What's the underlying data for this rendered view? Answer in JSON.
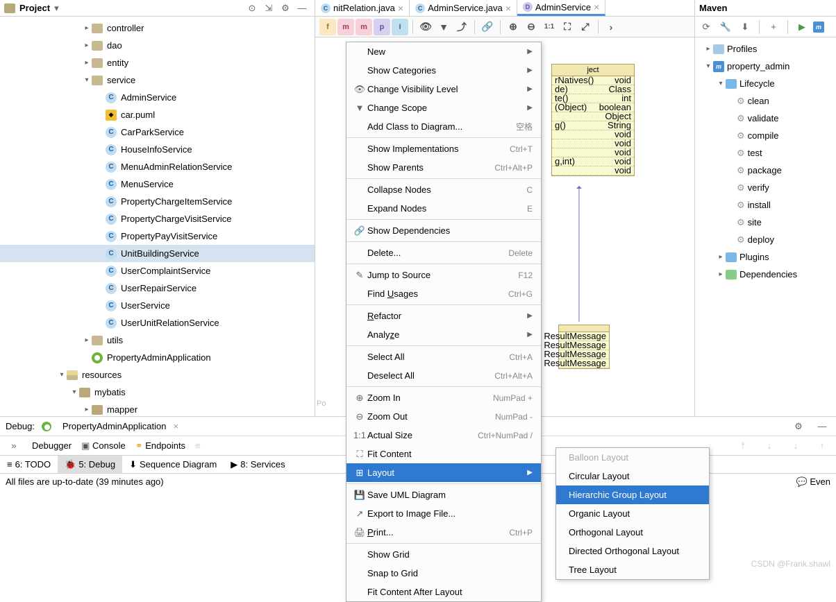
{
  "project": {
    "title": "Project",
    "tree": {
      "controller": "controller",
      "dao": "dao",
      "entity": "entity",
      "service": "service",
      "service_items": [
        "AdminService",
        "car.puml",
        "CarParkService",
        "HouseInfoService",
        "MenuAdminRelationService",
        "MenuService",
        "PropertyChargeItemService",
        "PropertyChargeVisitService",
        "PropertyPayVisitService",
        "UnitBuildingService",
        "UserComplaintService",
        "UserRepairService",
        "UserService",
        "UserUnitRelationService"
      ],
      "utils": "utils",
      "app": "PropertyAdminApplication",
      "resources": "resources",
      "mybatis": "mybatis",
      "mapper": "mapper"
    }
  },
  "tabs": [
    {
      "label": "nitRelation.java",
      "icon": "C",
      "active": false
    },
    {
      "label": "AdminService.java",
      "icon": "C",
      "active": false
    },
    {
      "label": "AdminService",
      "icon": "D",
      "active": true
    }
  ],
  "uml": {
    "box1_title": "ject",
    "box1_rows": [
      [
        "rNatives()",
        "void"
      ],
      [
        "de)",
        "Class<?>"
      ],
      [
        "te()",
        "int"
      ],
      [
        "(Object)",
        "boolean"
      ],
      [
        "",
        "Object"
      ],
      [
        "g()",
        "String"
      ],
      [
        "",
        "void"
      ],
      [
        "",
        "void"
      ],
      [
        "",
        "void"
      ],
      [
        "g,int)",
        "void"
      ],
      [
        "",
        "void"
      ]
    ],
    "box2_rows": [
      "ResultMessage",
      "ResultMessage",
      "ResultMessage",
      "ResultMessage"
    ],
    "powered": "Po"
  },
  "maven": {
    "title": "Maven",
    "profiles": "Profiles",
    "root": "property_admin",
    "lifecycle": "Lifecycle",
    "goals": [
      "clean",
      "validate",
      "compile",
      "test",
      "package",
      "verify",
      "install",
      "site",
      "deploy"
    ],
    "plugins": "Plugins",
    "dependencies": "Dependencies"
  },
  "debug": {
    "label": "Debug:",
    "run": "PropertyAdminApplication",
    "tabs": [
      "Debugger",
      "Console",
      "Endpoints"
    ]
  },
  "tool_windows": [
    {
      "label": "6: TODO",
      "icon": "≡"
    },
    {
      "label": "5: Debug",
      "icon": "🐞",
      "active": true
    },
    {
      "label": "Sequence Diagram",
      "icon": "⬇"
    },
    {
      "label": "8: Services",
      "icon": "▶"
    }
  ],
  "status": "All files are up-to-date (39 minutes ago)",
  "event_log": "Even",
  "context_menu": [
    {
      "label": "New",
      "arrow": true
    },
    {
      "label": "Show Categories",
      "arrow": true
    },
    {
      "label": "Change Visibility Level",
      "icon": "👁",
      "arrow": true
    },
    {
      "label": "Change Scope",
      "icon": "▼",
      "arrow": true
    },
    {
      "label": "Add Class to Diagram...",
      "shortcut": "空格"
    },
    {
      "sep": true
    },
    {
      "label": "Show Implementations",
      "shortcut": "Ctrl+T"
    },
    {
      "label": "Show Parents",
      "shortcut": "Ctrl+Alt+P"
    },
    {
      "sep": true
    },
    {
      "label": "Collapse Nodes",
      "shortcut": "C"
    },
    {
      "label": "Expand Nodes",
      "shortcut": "E"
    },
    {
      "sep": true
    },
    {
      "label": "Show Dependencies",
      "icon": "🔗"
    },
    {
      "sep": true
    },
    {
      "label": "Delete...",
      "shortcut": "Delete"
    },
    {
      "sep": true
    },
    {
      "label": "Jump to Source",
      "icon": "✎",
      "shortcut": "F12"
    },
    {
      "label": "Find Usages",
      "shortcut": "Ctrl+G",
      "u": 5
    },
    {
      "sep": true
    },
    {
      "label": "Refactor",
      "arrow": true,
      "u": 0
    },
    {
      "label": "Analyze",
      "arrow": true,
      "u": 5
    },
    {
      "sep": true
    },
    {
      "label": "Select All",
      "shortcut": "Ctrl+A"
    },
    {
      "label": "Deselect All",
      "shortcut": "Ctrl+Alt+A"
    },
    {
      "sep": true
    },
    {
      "label": "Zoom In",
      "icon": "⊕",
      "shortcut": "NumPad +"
    },
    {
      "label": "Zoom Out",
      "icon": "⊖",
      "shortcut": "NumPad -"
    },
    {
      "label": "Actual Size",
      "icon": "1:1",
      "shortcut": "Ctrl+NumPad /"
    },
    {
      "label": "Fit Content",
      "icon": "⛶"
    },
    {
      "label": "Layout",
      "icon": "⊞",
      "arrow": true,
      "highlighted": true
    },
    {
      "sep": true
    },
    {
      "label": "Save UML Diagram",
      "icon": "💾"
    },
    {
      "label": "Export to Image File...",
      "icon": "↗"
    },
    {
      "label": "Print...",
      "icon": "🖨",
      "shortcut": "Ctrl+P",
      "u": 0
    },
    {
      "sep": true
    },
    {
      "label": "Show Grid"
    },
    {
      "label": "Snap to Grid"
    },
    {
      "label": "Fit Content After Layout"
    }
  ],
  "submenu": [
    {
      "label": "Balloon Layout",
      "disabled": true
    },
    {
      "label": "Circular Layout"
    },
    {
      "label": "Hierarchic Group Layout",
      "highlighted": true
    },
    {
      "label": "Organic Layout"
    },
    {
      "label": "Orthogonal Layout"
    },
    {
      "label": "Directed Orthogonal Layout"
    },
    {
      "label": "Tree Layout"
    }
  ],
  "watermark": "CSDN @Frank.shawl"
}
